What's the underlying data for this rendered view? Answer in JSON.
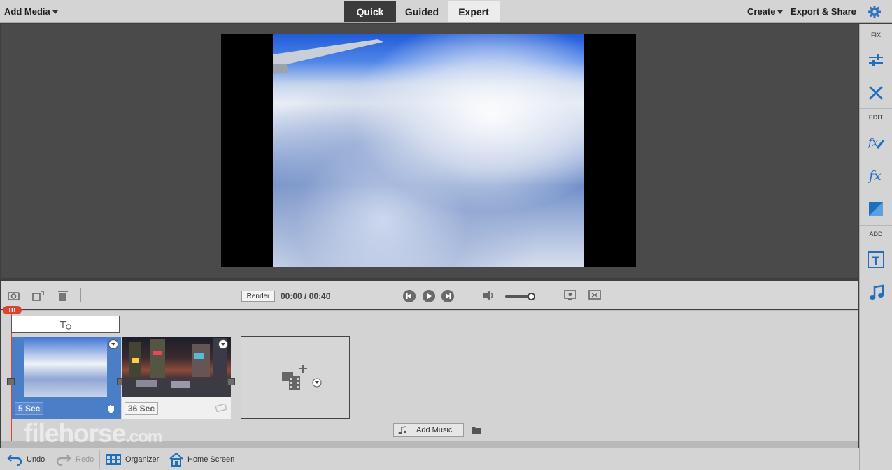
{
  "topbar": {
    "add_media": "Add Media",
    "modes": [
      "Quick",
      "Guided",
      "Expert"
    ],
    "active_mode": "Quick",
    "create": "Create",
    "export_share": "Export & Share"
  },
  "right_panel": {
    "fix_label": "FIX",
    "edit_label": "EDIT",
    "add_label": "ADD"
  },
  "controls": {
    "render": "Render",
    "timecode": "00:00 / 00:40",
    "volume_level": 0.9
  },
  "timeline": {
    "clips": [
      {
        "duration": "5 Sec",
        "selected": true
      },
      {
        "duration": "36 Sec",
        "selected": false
      }
    ],
    "add_music": "Add Music"
  },
  "bottombar": {
    "undo": "Undo",
    "redo": "Redo",
    "organizer": "Organizer",
    "home_screen": "Home Screen"
  },
  "watermark": {
    "brand": "filehorse",
    "tld": ".com"
  },
  "colors": {
    "accent": "#d9442f",
    "selected_clip": "#4a7fc8",
    "icon_blue": "#1f6fbf"
  }
}
